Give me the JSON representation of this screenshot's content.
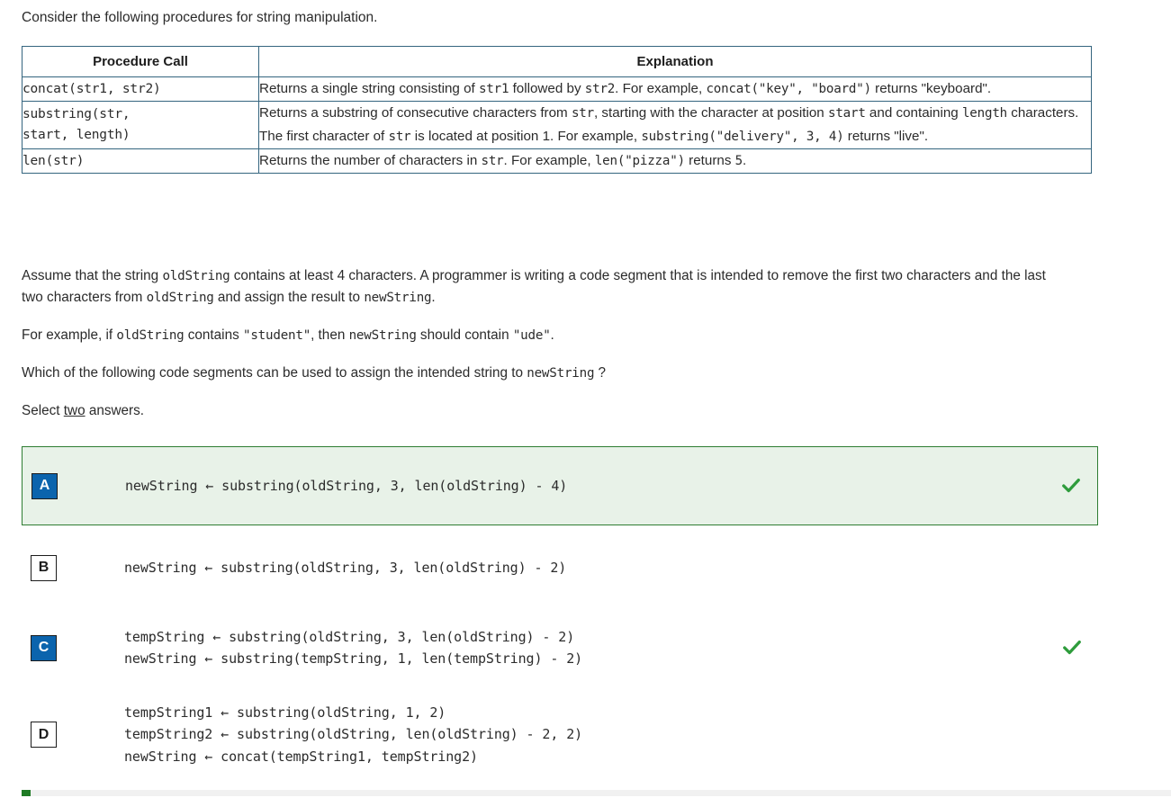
{
  "intro": "Consider the following procedures for string manipulation.",
  "table": {
    "headers": [
      "Procedure Call",
      "Explanation"
    ],
    "rows": [
      {
        "call": "concat(str1, str2)",
        "explanation_parts": [
          {
            "t": "Returns a single string consisting of ",
            "m": false
          },
          {
            "t": "str1",
            "m": true
          },
          {
            "t": " followed by ",
            "m": false
          },
          {
            "t": "str2",
            "m": true
          },
          {
            "t": ". For example, ",
            "m": false
          },
          {
            "t": "concat(\"key\", \"board\")",
            "m": true
          },
          {
            "t": " returns \"keyboard\".",
            "m": false
          }
        ]
      },
      {
        "call": "substring(str,\nstart, length)",
        "explanation_parts": [
          {
            "t": "Returns a substring of consecutive characters from ",
            "m": false
          },
          {
            "t": "str",
            "m": true
          },
          {
            "t": ", starting with the character at position ",
            "m": false
          },
          {
            "t": "start",
            "m": true
          },
          {
            "t": " and containing ",
            "m": false
          },
          {
            "t": "length",
            "m": true
          },
          {
            "t": " characters. The first character of ",
            "m": false
          },
          {
            "t": "str",
            "m": true
          },
          {
            "t": " is located at position 1. For example, ",
            "m": false
          },
          {
            "t": "substring(\"delivery\", 3, 4)",
            "m": true
          },
          {
            "t": " returns \"live\".",
            "m": false
          }
        ]
      },
      {
        "call": "len(str)",
        "explanation_parts": [
          {
            "t": "Returns the number of characters in ",
            "m": false
          },
          {
            "t": "str",
            "m": true
          },
          {
            "t": ". For example, ",
            "m": false
          },
          {
            "t": "len(\"pizza\")",
            "m": true
          },
          {
            "t": " returns ",
            "m": false
          },
          {
            "t": "5",
            "m": true
          },
          {
            "t": ".",
            "m": false
          }
        ]
      }
    ]
  },
  "paragraphs": {
    "assume_1": "Assume that the string ",
    "assume_code_1": "oldString",
    "assume_2": " contains at least 4 characters. A programmer is writing a code segment that is intended to remove the first two characters and the last two characters from ",
    "assume_code_2": "oldString",
    "assume_3": " and assign the result to ",
    "assume_code_3": "newString",
    "assume_4": ".",
    "example_1": "For example, if ",
    "example_code_1": "oldString",
    "example_2": " contains ",
    "example_code_2": "\"student\"",
    "example_3": ", then ",
    "example_code_3": "newString",
    "example_4": " should contain ",
    "example_code_4": "\"ude\"",
    "example_5": ".",
    "question_1": "Which of the following code segments can be used to assign the intended string to ",
    "question_code": "newString",
    "question_2": " ?",
    "select_1": "Select ",
    "select_emph": "two",
    "select_2": " answers."
  },
  "choices": [
    {
      "letter": "A",
      "selected": true,
      "correct": true,
      "highlighted": true,
      "code": "newString ← substring(oldString, 3, len(oldString) - 4)"
    },
    {
      "letter": "B",
      "selected": false,
      "correct": false,
      "highlighted": false,
      "code": "newString ← substring(oldString, 3, len(oldString) - 2)"
    },
    {
      "letter": "C",
      "selected": true,
      "correct": true,
      "highlighted": false,
      "code": "tempString ← substring(oldString, 3, len(oldString) - 2)\nnewString ← substring(tempString, 1, len(tempString) - 2)"
    },
    {
      "letter": "D",
      "selected": false,
      "correct": false,
      "highlighted": false,
      "code": "tempString1 ← substring(oldString, 1, 2)\ntempString2 ← substring(oldString, len(oldString) - 2, 2)\nnewString ← concat(tempString1, tempString2)"
    }
  ],
  "colors": {
    "table_border": "#34657f",
    "highlight_bg": "#e8f2e8",
    "highlight_border": "#2e7d32",
    "badge_selected": "#0b64ad",
    "check_green": "#2e9c3c",
    "progress_fill": "#1e7b24",
    "progress_track": "#f1f1f1"
  }
}
